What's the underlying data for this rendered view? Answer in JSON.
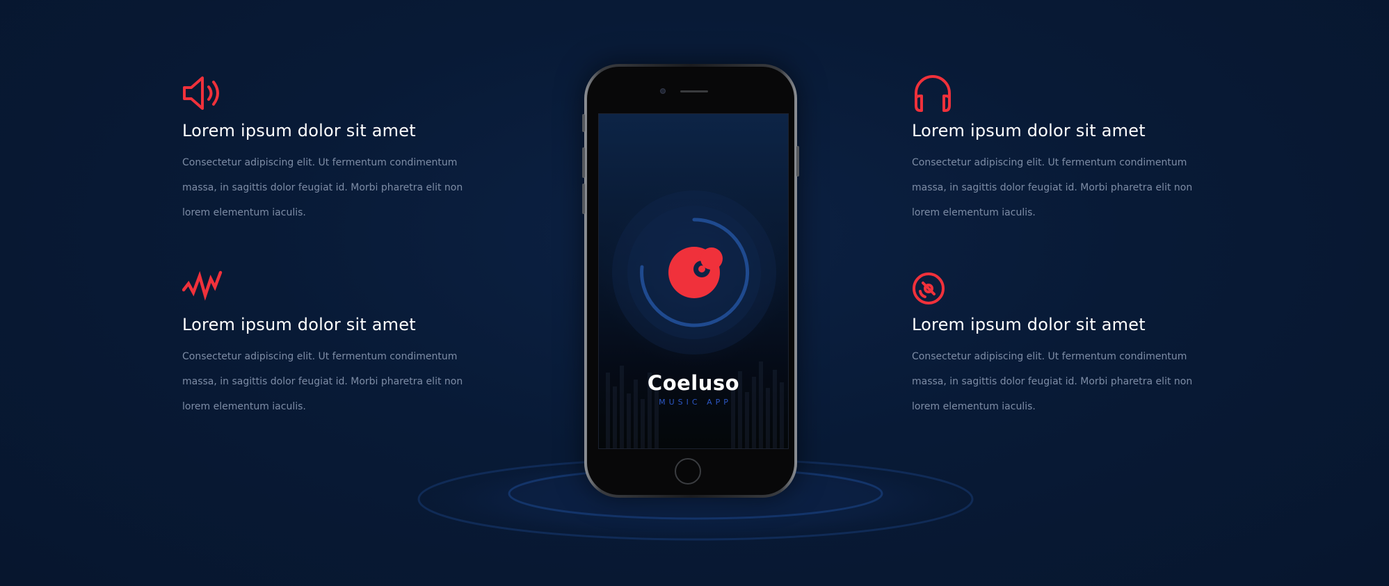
{
  "app": {
    "name": "Coeluso",
    "tagline": "MUSIC APP"
  },
  "features": [
    {
      "icon": "speaker-icon",
      "title": "Lorem ipsum dolor sit amet",
      "description": "Consectetur adipiscing elit. Ut fermentum condimentum massa, in sagittis dolor feugiat id. Morbi pharetra elit non lorem elementum iaculis."
    },
    {
      "icon": "headphones-icon",
      "title": "Lorem ipsum dolor sit amet",
      "description": "Consectetur adipiscing elit. Ut fermentum condimentum massa, in sagittis dolor feugiat id. Morbi pharetra elit non lorem elementum iaculis."
    },
    {
      "icon": "pulse-icon",
      "title": "Lorem ipsum dolor sit amet",
      "description": "Consectetur adipiscing elit. Ut fermentum condimentum massa, in sagittis dolor feugiat id. Morbi pharetra elit non lorem elementum iaculis."
    },
    {
      "icon": "disc-icon",
      "title": "Lorem ipsum dolor sit amet",
      "description": "Consectetur adipiscing elit. Ut fermentum condimentum massa, in sagittis dolor feugiat id. Morbi pharetra elit non lorem elementum iaculis."
    }
  ],
  "colors": {
    "background": "#081a36",
    "accent": "#f0313b",
    "tagline": "#2c57c4",
    "text_secondary": "#7d8ca5"
  }
}
